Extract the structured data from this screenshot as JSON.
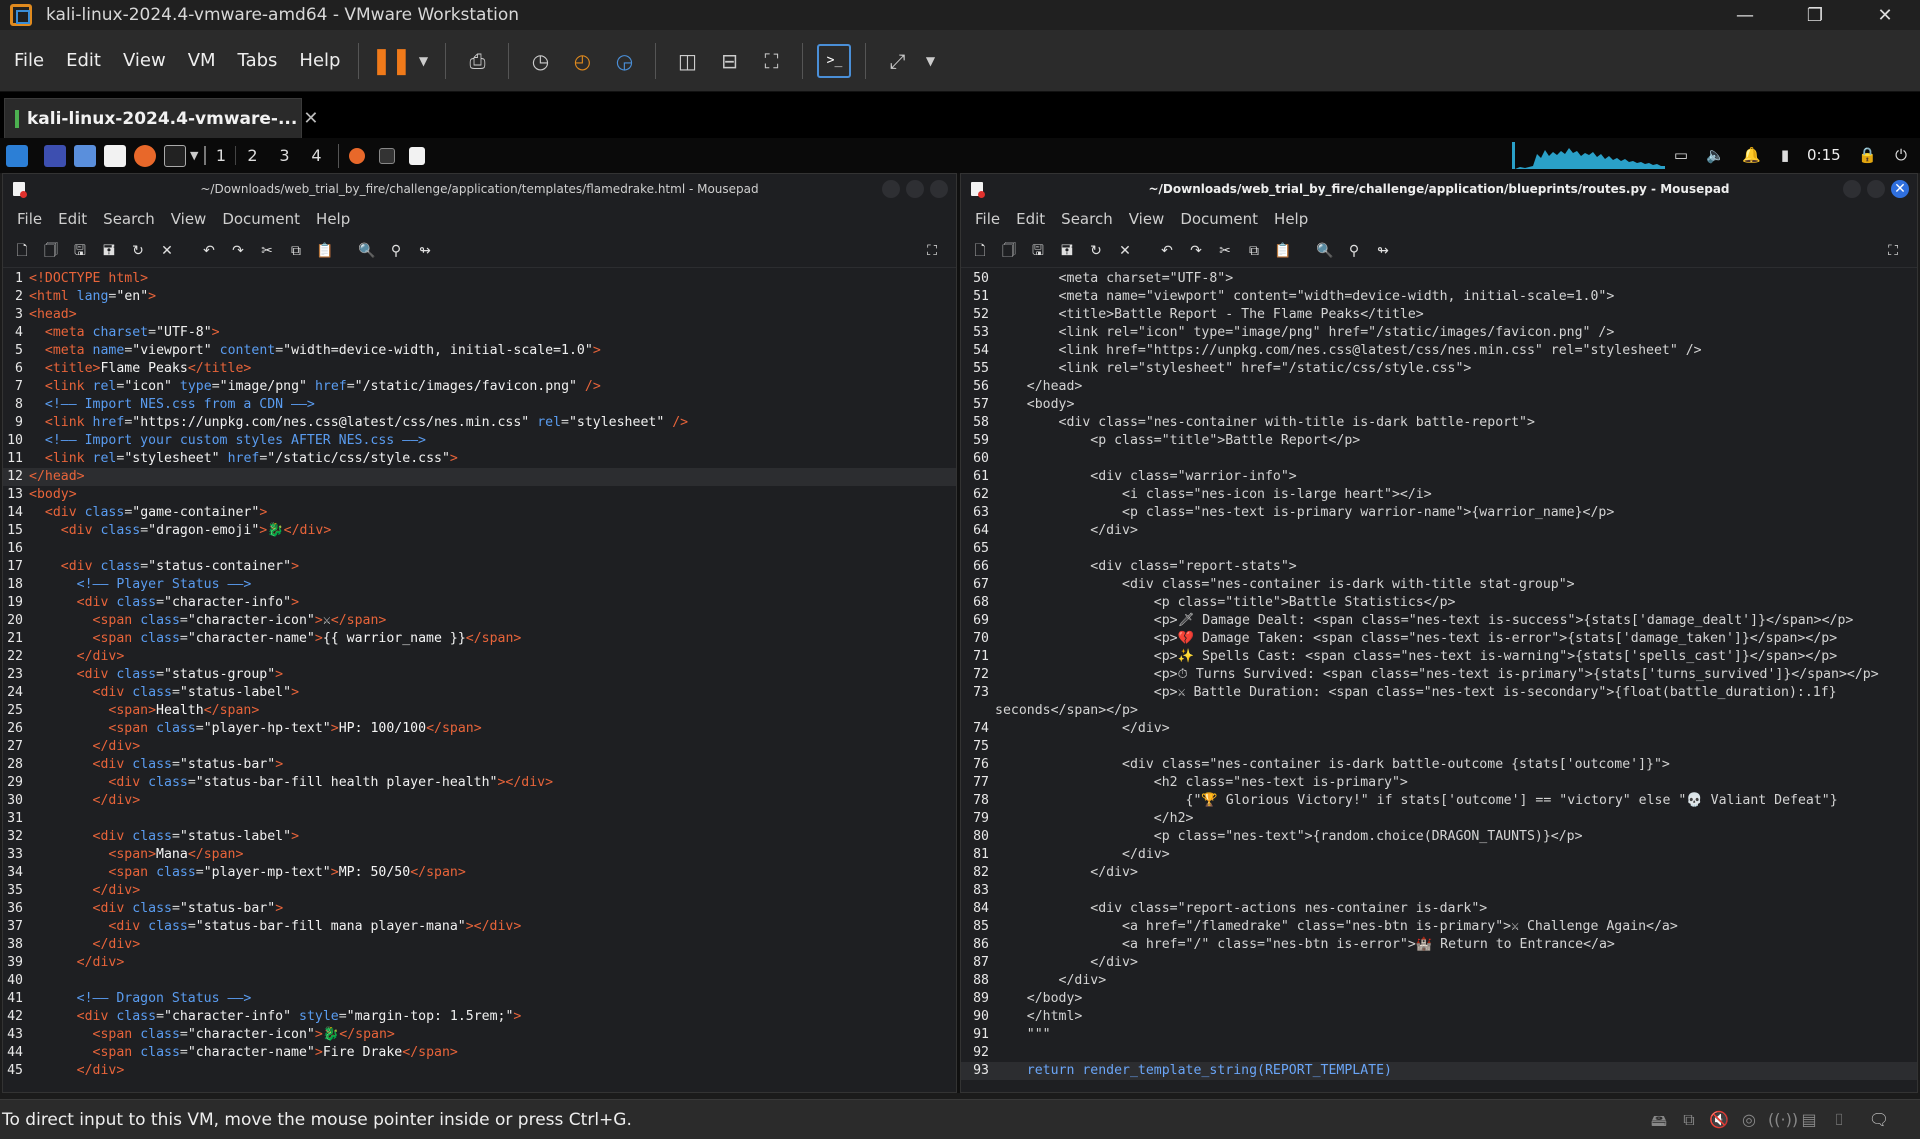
{
  "vmware": {
    "title": "kali-linux-2024.4-vmware-amd64 - VMware Workstation",
    "menu": [
      "File",
      "Edit",
      "View",
      "VM",
      "Tabs",
      "Help"
    ],
    "tab_label": "kali-linux-2024.4-vmware-...",
    "status_message": "To direct input to this VM, move the mouse pointer inside or press Ctrl+G."
  },
  "panel": {
    "workspaces": [
      "1",
      "2",
      "3",
      "4"
    ],
    "clock": "0:15"
  },
  "left_editor": {
    "title": "~/Downloads/web_trial_by_fire/challenge/application/templates/flamedrake.html - Mousepad",
    "menu": [
      "File",
      "Edit",
      "Search",
      "View",
      "Document",
      "Help"
    ],
    "lines": [
      {
        "n": "1",
        "h": "<span class='t'>&lt;!DOCTYPE html&gt;</span>"
      },
      {
        "n": "2",
        "h": "<span class='t'>&lt;html</span> <span class='a'>lang</span>=<span class='s'>\"en\"</span><span class='t'>&gt;</span>"
      },
      {
        "n": "3",
        "h": "<span class='t'>&lt;head&gt;</span>"
      },
      {
        "n": "4",
        "h": "  <span class='t'>&lt;meta</span> <span class='a'>charset</span>=<span class='s'>\"UTF-8\"</span><span class='t'>&gt;</span>"
      },
      {
        "n": "5",
        "h": "  <span class='t'>&lt;meta</span> <span class='a'>name</span>=<span class='s'>\"viewport\"</span> <span class='a'>content</span>=<span class='s'>\"width=device-width, initial-scale=1.0\"</span><span class='t'>&gt;</span>"
      },
      {
        "n": "6",
        "h": "  <span class='t'>&lt;title&gt;</span><span class='tx'>Flame Peaks</span><span class='t'>&lt;/title&gt;</span>"
      },
      {
        "n": "7",
        "h": "  <span class='t'>&lt;link</span> <span class='a'>rel</span>=<span class='s'>\"icon\"</span> <span class='a'>type</span>=<span class='s'>\"image/png\"</span> <span class='a'>href</span>=<span class='s'>\"/static/images/favicon.png\"</span> <span class='t'>/&gt;</span>"
      },
      {
        "n": "8",
        "h": "  <span class='cm'>&lt;!—— Import NES.css from a CDN ——&gt;</span>"
      },
      {
        "n": "9",
        "h": "  <span class='t'>&lt;link</span> <span class='a'>href</span>=<span class='s'>\"https://unpkg.com/nes.css@latest/css/nes.min.css\"</span> <span class='a'>rel</span>=<span class='s'>\"stylesheet\"</span> <span class='t'>/&gt;</span>"
      },
      {
        "n": "10",
        "h": "  <span class='cm'>&lt;!—— Import your custom styles AFTER NES.css ——&gt;</span>"
      },
      {
        "n": "11",
        "h": "  <span class='t'>&lt;link</span> <span class='a'>rel</span>=<span class='s'>\"stylesheet\"</span> <span class='a'>href</span>=<span class='s'>\"/static/css/style.css\"</span><span class='t'>&gt;</span>"
      },
      {
        "n": "12",
        "h": "<span class='t'>&lt;/head&gt;</span>",
        "cur": true
      },
      {
        "n": "13",
        "h": "<span class='t'>&lt;body&gt;</span>"
      },
      {
        "n": "14",
        "h": "  <span class='t'>&lt;div</span> <span class='a'>class</span>=<span class='s'>\"game-container\"</span><span class='t'>&gt;</span>"
      },
      {
        "n": "15",
        "h": "    <span class='t'>&lt;div</span> <span class='a'>class</span>=<span class='s'>\"dragon-emoji\"</span><span class='t'>&gt;</span>🐉<span class='t'>&lt;/div&gt;</span>"
      },
      {
        "n": "16",
        "h": ""
      },
      {
        "n": "17",
        "h": "    <span class='t'>&lt;div</span> <span class='a'>class</span>=<span class='s'>\"status-container\"</span><span class='t'>&gt;</span>"
      },
      {
        "n": "18",
        "h": "      <span class='cm'>&lt;!—— Player Status ——&gt;</span>"
      },
      {
        "n": "19",
        "h": "      <span class='t'>&lt;div</span> <span class='a'>class</span>=<span class='s'>\"character-info\"</span><span class='t'>&gt;</span>"
      },
      {
        "n": "20",
        "h": "        <span class='t'>&lt;span</span> <span class='a'>class</span>=<span class='s'>\"character-icon\"</span><span class='t'>&gt;</span>⚔<span class='t'>&lt;/span&gt;</span>"
      },
      {
        "n": "21",
        "h": "        <span class='t'>&lt;span</span> <span class='a'>class</span>=<span class='s'>\"character-name\"</span><span class='t'>&gt;</span><span class='tx'>{{ warrior_name }}</span><span class='t'>&lt;/span&gt;</span>"
      },
      {
        "n": "22",
        "h": "      <span class='t'>&lt;/div&gt;</span>"
      },
      {
        "n": "23",
        "h": "      <span class='t'>&lt;div</span> <span class='a'>class</span>=<span class='s'>\"status-group\"</span><span class='t'>&gt;</span>"
      },
      {
        "n": "24",
        "h": "        <span class='t'>&lt;div</span> <span class='a'>class</span>=<span class='s'>\"status-label\"</span><span class='t'>&gt;</span>"
      },
      {
        "n": "25",
        "h": "          <span class='t'>&lt;span&gt;</span><span class='tx'>Health</span><span class='t'>&lt;/span&gt;</span>"
      },
      {
        "n": "26",
        "h": "          <span class='t'>&lt;span</span> <span class='a'>class</span>=<span class='s'>\"player-hp-text\"</span><span class='t'>&gt;</span><span class='tx'>HP: 100/100</span><span class='t'>&lt;/span&gt;</span>"
      },
      {
        "n": "27",
        "h": "        <span class='t'>&lt;/div&gt;</span>"
      },
      {
        "n": "28",
        "h": "        <span class='t'>&lt;div</span> <span class='a'>class</span>=<span class='s'>\"status-bar\"</span><span class='t'>&gt;</span>"
      },
      {
        "n": "29",
        "h": "          <span class='t'>&lt;div</span> <span class='a'>class</span>=<span class='s'>\"status-bar-fill health player-health\"</span><span class='t'>&gt;&lt;/div&gt;</span>"
      },
      {
        "n": "30",
        "h": "        <span class='t'>&lt;/div&gt;</span>"
      },
      {
        "n": "31",
        "h": ""
      },
      {
        "n": "32",
        "h": "        <span class='t'>&lt;div</span> <span class='a'>class</span>=<span class='s'>\"status-label\"</span><span class='t'>&gt;</span>"
      },
      {
        "n": "33",
        "h": "          <span class='t'>&lt;span&gt;</span><span class='tx'>Mana</span><span class='t'>&lt;/span&gt;</span>"
      },
      {
        "n": "34",
        "h": "          <span class='t'>&lt;span</span> <span class='a'>class</span>=<span class='s'>\"player-mp-text\"</span><span class='t'>&gt;</span><span class='tx'>MP: 50/50</span><span class='t'>&lt;/span&gt;</span>"
      },
      {
        "n": "35",
        "h": "        <span class='t'>&lt;/div&gt;</span>"
      },
      {
        "n": "36",
        "h": "        <span class='t'>&lt;div</span> <span class='a'>class</span>=<span class='s'>\"status-bar\"</span><span class='t'>&gt;</span>"
      },
      {
        "n": "37",
        "h": "          <span class='t'>&lt;div</span> <span class='a'>class</span>=<span class='s'>\"status-bar-fill mana player-mana\"</span><span class='t'>&gt;&lt;/div&gt;</span>"
      },
      {
        "n": "38",
        "h": "        <span class='t'>&lt;/div&gt;</span>"
      },
      {
        "n": "39",
        "h": "      <span class='t'>&lt;/div&gt;</span>"
      },
      {
        "n": "40",
        "h": ""
      },
      {
        "n": "41",
        "h": "      <span class='cm'>&lt;!—— Dragon Status ——&gt;</span>"
      },
      {
        "n": "42",
        "h": "      <span class='t'>&lt;div</span> <span class='a'>class</span>=<span class='s'>\"character-info\"</span> <span class='a'>style</span>=<span class='s'>\"margin-top: 1.5rem;\"</span><span class='t'>&gt;</span>"
      },
      {
        "n": "43",
        "h": "        <span class='t'>&lt;span</span> <span class='a'>class</span>=<span class='s'>\"character-icon\"</span><span class='t'>&gt;</span>🐉<span class='t'>&lt;/span&gt;</span>"
      },
      {
        "n": "44",
        "h": "        <span class='t'>&lt;span</span> <span class='a'>class</span>=<span class='s'>\"character-name\"</span><span class='t'>&gt;</span><span class='tx'>Fire Drake</span><span class='t'>&lt;/span&gt;</span>"
      },
      {
        "n": "45",
        "h": "      <span class='t'>&lt;/div&gt;</span>"
      }
    ]
  },
  "right_editor": {
    "title": "~/Downloads/web_trial_by_fire/challenge/application/blueprints/routes.py - Mousepad",
    "menu": [
      "File",
      "Edit",
      "Search",
      "View",
      "Document",
      "Help"
    ],
    "lines": [
      {
        "n": "50",
        "h": "        &lt;meta charset=\"UTF-8\"&gt;"
      },
      {
        "n": "51",
        "h": "        &lt;meta name=\"viewport\" content=\"width=device-width, initial-scale=1.0\"&gt;"
      },
      {
        "n": "52",
        "h": "        &lt;title&gt;Battle Report - The Flame Peaks&lt;/title&gt;"
      },
      {
        "n": "53",
        "h": "        &lt;link rel=\"icon\" type=\"image/png\" href=\"/static/images/favicon.png\" /&gt;"
      },
      {
        "n": "54",
        "h": "        &lt;link href=\"https://unpkg.com/nes.css@latest/css/nes.min.css\" rel=\"stylesheet\" /&gt;"
      },
      {
        "n": "55",
        "h": "        &lt;link rel=\"stylesheet\" href=\"/static/css/style.css\"&gt;"
      },
      {
        "n": "56",
        "h": "    &lt;/head&gt;"
      },
      {
        "n": "57",
        "h": "    &lt;body&gt;"
      },
      {
        "n": "58",
        "h": "        &lt;div class=\"nes-container with-title is-dark battle-report\"&gt;"
      },
      {
        "n": "59",
        "h": "            &lt;p class=\"title\"&gt;Battle Report&lt;/p&gt;"
      },
      {
        "n": "60",
        "h": ""
      },
      {
        "n": "61",
        "h": "            &lt;div class=\"warrior-info\"&gt;"
      },
      {
        "n": "62",
        "h": "                &lt;i class=\"nes-icon is-large heart\"&gt;&lt;/i&gt;"
      },
      {
        "n": "63",
        "h": "                &lt;p class=\"nes-text is-primary warrior-name\"&gt;{warrior_name}&lt;/p&gt;"
      },
      {
        "n": "64",
        "h": "            &lt;/div&gt;"
      },
      {
        "n": "65",
        "h": ""
      },
      {
        "n": "66",
        "h": "            &lt;div class=\"report-stats\"&gt;"
      },
      {
        "n": "67",
        "h": "                &lt;div class=\"nes-container is-dark with-title stat-group\"&gt;"
      },
      {
        "n": "68",
        "h": "                    &lt;p class=\"title\"&gt;Battle Statistics&lt;/p&gt;"
      },
      {
        "n": "69",
        "h": "                    &lt;p&gt;🗡 Damage Dealt: &lt;span class=\"nes-text is-success\"&gt;{stats['damage_dealt']}&lt;/span&gt;&lt;/p&gt;"
      },
      {
        "n": "70",
        "h": "                    &lt;p&gt;💔 Damage Taken: &lt;span class=\"nes-text is-error\"&gt;{stats['damage_taken']}&lt;/span&gt;&lt;/p&gt;"
      },
      {
        "n": "71",
        "h": "                    &lt;p&gt;✨ Spells Cast: &lt;span class=\"nes-text is-warning\"&gt;{stats['spells_cast']}&lt;/span&gt;&lt;/p&gt;"
      },
      {
        "n": "72",
        "h": "                    &lt;p&gt;⏱ Turns Survived: &lt;span class=\"nes-text is-primary\"&gt;{stats['turns_survived']}&lt;/span&gt;&lt;/p&gt;"
      },
      {
        "n": "73",
        "h": "                    &lt;p&gt;⚔ Battle Duration: &lt;span class=\"nes-text is-secondary\"&gt;{float(battle_duration):.1f}"
      },
      {
        "n": "",
        "h": "seconds&lt;/span&gt;&lt;/p&gt;"
      },
      {
        "n": "74",
        "h": "                &lt;/div&gt;"
      },
      {
        "n": "75",
        "h": ""
      },
      {
        "n": "76",
        "h": "                &lt;div class=\"nes-container is-dark battle-outcome {stats['outcome']}\"&gt;"
      },
      {
        "n": "77",
        "h": "                    &lt;h2 class=\"nes-text is-primary\"&gt;"
      },
      {
        "n": "78",
        "h": "                        {\"🏆 Glorious Victory!\" if stats['outcome'] == \"victory\" else \"💀 Valiant Defeat\"}"
      },
      {
        "n": "79",
        "h": "                    &lt;/h2&gt;"
      },
      {
        "n": "80",
        "h": "                    &lt;p class=\"nes-text\"&gt;{random.choice(DRAGON_TAUNTS)}&lt;/p&gt;"
      },
      {
        "n": "81",
        "h": "                &lt;/div&gt;"
      },
      {
        "n": "82",
        "h": "            &lt;/div&gt;"
      },
      {
        "n": "83",
        "h": ""
      },
      {
        "n": "84",
        "h": "            &lt;div class=\"report-actions nes-container is-dark\"&gt;"
      },
      {
        "n": "85",
        "h": "                &lt;a href=\"/flamedrake\" class=\"nes-btn is-primary\"&gt;⚔ Challenge Again&lt;/a&gt;"
      },
      {
        "n": "86",
        "h": "                &lt;a href=\"/\" class=\"nes-btn is-error\"&gt;🏰 Return to Entrance&lt;/a&gt;"
      },
      {
        "n": "87",
        "h": "            &lt;/div&gt;"
      },
      {
        "n": "88",
        "h": "        &lt;/div&gt;"
      },
      {
        "n": "89",
        "h": "    &lt;/body&gt;"
      },
      {
        "n": "90",
        "h": "    &lt;/html&gt;"
      },
      {
        "n": "91",
        "h": "    \"\"\""
      },
      {
        "n": "92",
        "h": ""
      },
      {
        "n": "93",
        "h": "    <span class='py'>return render_template_string(REPORT_TEMPLATE)</span>",
        "cur": true
      }
    ]
  }
}
